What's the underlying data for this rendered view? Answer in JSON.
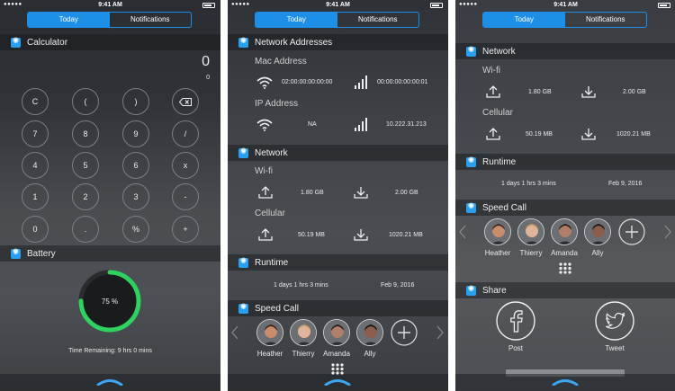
{
  "status": {
    "time": "9:41 AM",
    "signal": "●●●●● "
  },
  "tabs": {
    "today": "Today",
    "notifications": "Notifications"
  },
  "calculator": {
    "title": "Calculator",
    "display": "0",
    "memory": "0",
    "keys": [
      "C",
      "(",
      ")",
      "7",
      "8",
      "9",
      "/",
      "4",
      "5",
      "6",
      "x",
      "1",
      "2",
      "3",
      "-",
      "0",
      ".",
      "%",
      "+"
    ]
  },
  "battery": {
    "title": "Battery",
    "percent_label": "75 %",
    "level": 0.75,
    "remaining": "Time Remaining: 9 hrs 0 mins",
    "ring_color": "#2fd160"
  },
  "network_addresses": {
    "title": "Network Addresses",
    "mac_label": "Mac Address",
    "mac_wifi": "02:00:00:00:00:00",
    "mac_cell": "00:00:00:00:00:01",
    "ip_label": "IP Address",
    "ip_wifi": "NA",
    "ip_cell": "10.222.31.213"
  },
  "network": {
    "title": "Network",
    "wifi_label": "Wi-fi",
    "wifi_up": "1.80 GB",
    "wifi_down": "2.00 GB",
    "cell_label": "Cellular",
    "cell_up": "50.19 MB",
    "cell_down": "1020.21 MB"
  },
  "runtime": {
    "title": "Runtime",
    "uptime": "1 days 1 hrs 3 mins",
    "date": "Feb 9, 2016"
  },
  "speed_call": {
    "title": "Speed Call",
    "contacts": [
      "Heather",
      "Thierry",
      "Amanda",
      "Ally"
    ]
  },
  "share": {
    "title": "Share",
    "post": "Post",
    "tweet": "Tweet"
  },
  "colors": {
    "accent": "#1d8fe6",
    "battery": "#2fd160"
  }
}
